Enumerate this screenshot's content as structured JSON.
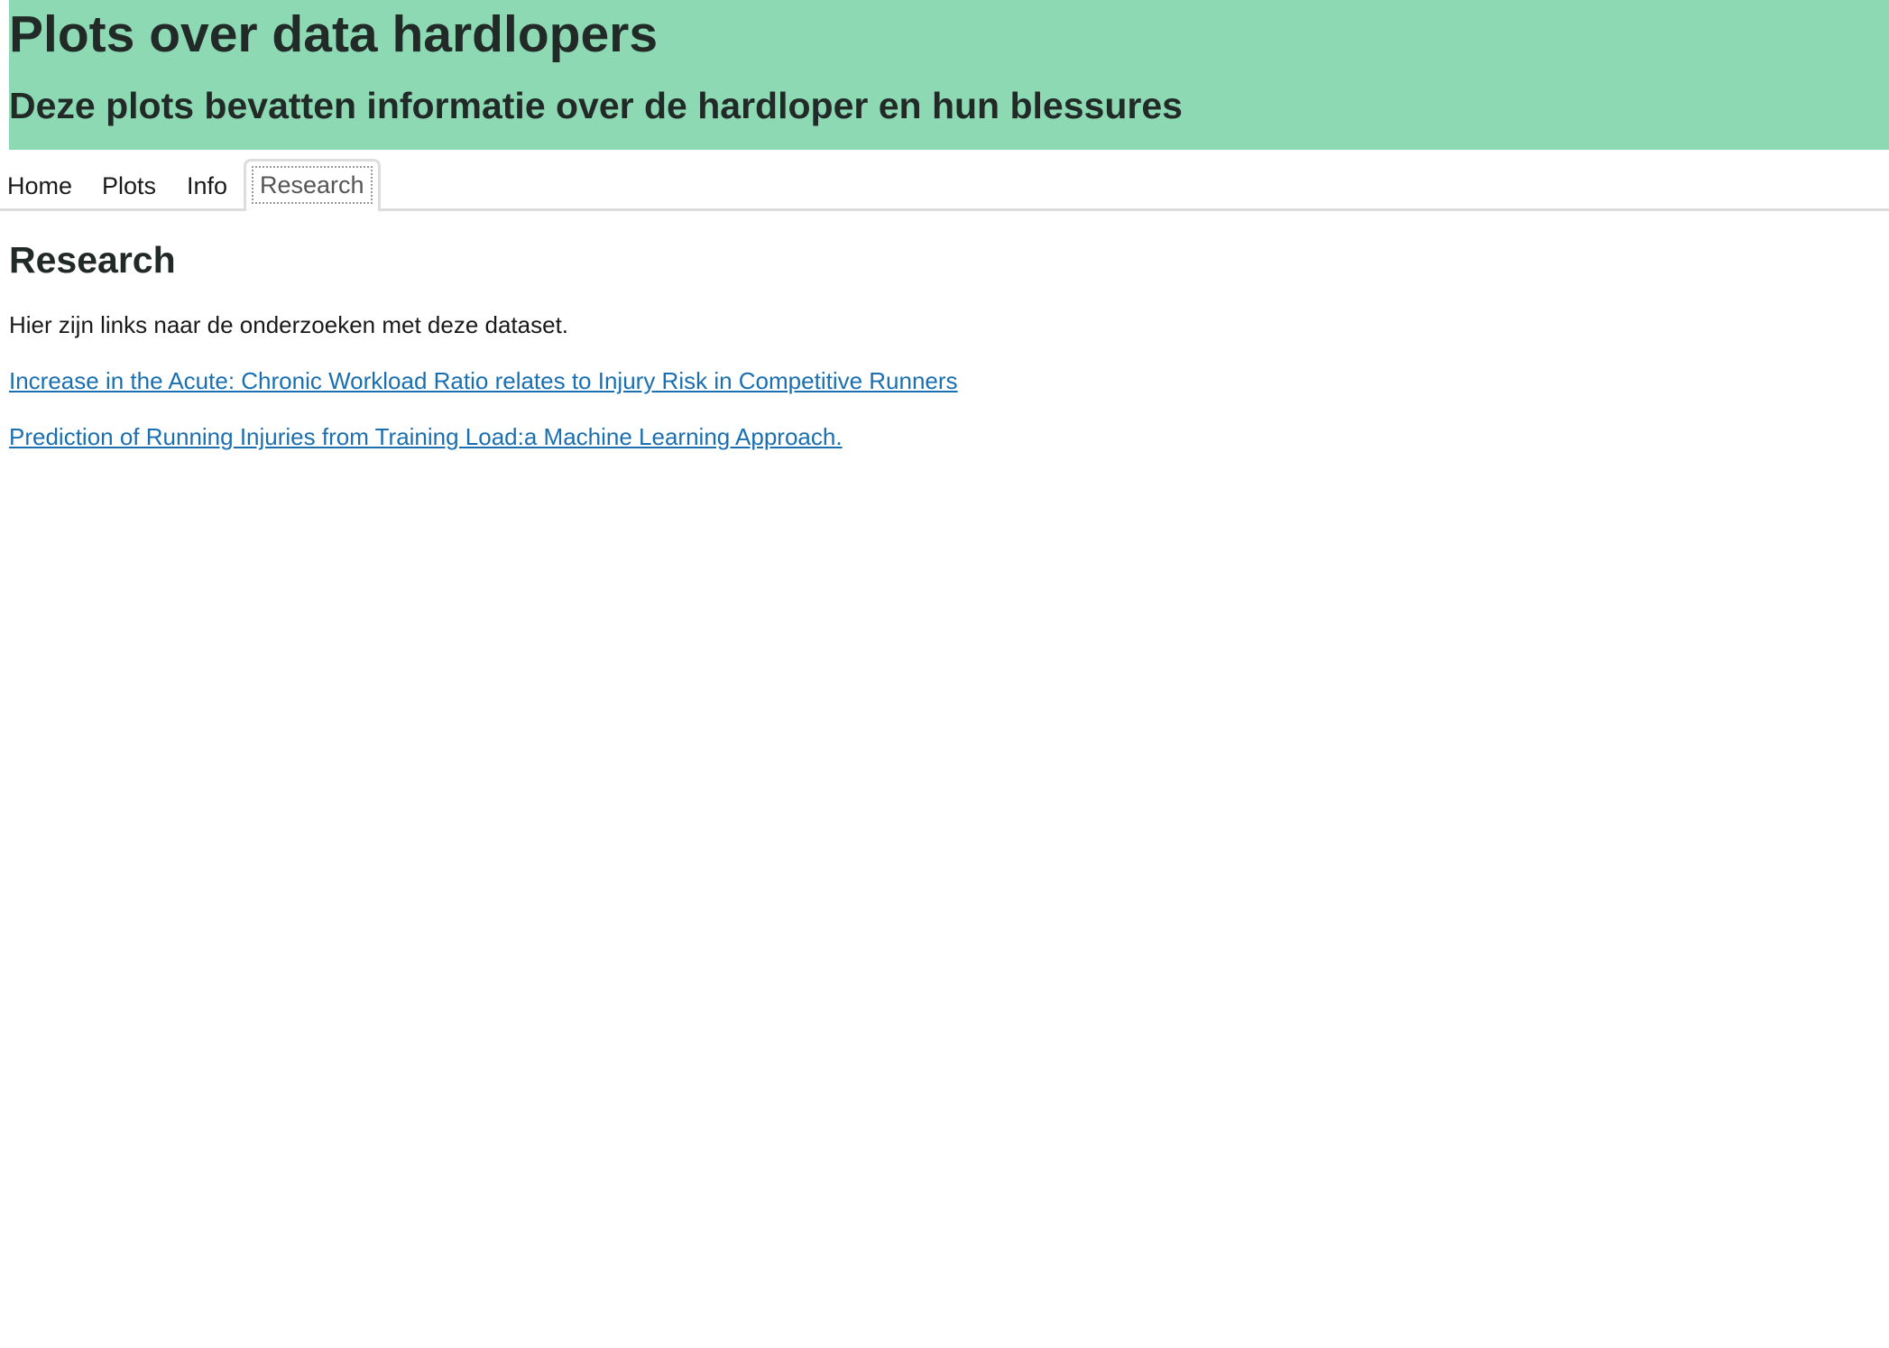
{
  "header": {
    "title": "Plots over data hardlopers",
    "subtitle": "Deze plots bevatten informatie over de hardloper en hun blessures",
    "background_color": "#8dd9b3"
  },
  "tabs": [
    {
      "label": "Home",
      "active": false
    },
    {
      "label": "Plots",
      "active": false
    },
    {
      "label": "Info",
      "active": false
    },
    {
      "label": "Research",
      "active": true
    }
  ],
  "content": {
    "heading": "Research",
    "intro": "Hier zijn links naar de onderzoeken met deze dataset.",
    "links": [
      {
        "text": "Increase in the Acute: Chronic Workload Ratio relates to Injury Risk in Competitive Runners"
      },
      {
        "text": "Prediction of Running Injuries from Training Load:a Machine Learning Approach."
      }
    ],
    "link_color": "#1a6fb0"
  }
}
